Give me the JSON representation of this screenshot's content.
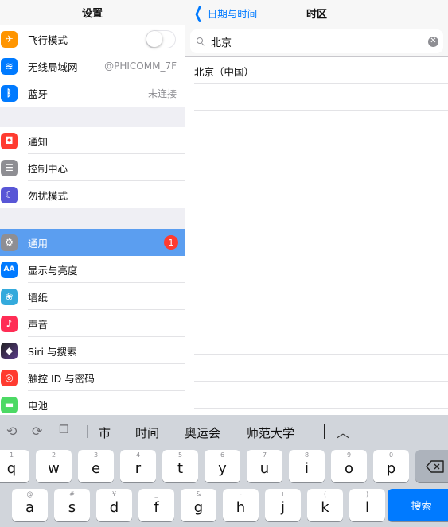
{
  "sidebar": {
    "title": "设置",
    "groups": [
      [
        {
          "label": "飞行模式",
          "icon": "airplane-icon",
          "color": "#ff9500",
          "glyph": "✈"
        },
        {
          "label": "无线局域网",
          "icon": "wifi-icon",
          "color": "#007aff",
          "glyph": "≋",
          "value": "@PHICOMM_7F"
        },
        {
          "label": "蓝牙",
          "icon": "bluetooth-icon",
          "color": "#007aff",
          "glyph": "ᛒ",
          "value": "未连接"
        }
      ],
      [
        {
          "label": "通知",
          "icon": "notifications-icon",
          "color": "#ff3b30",
          "glyph": "◘"
        },
        {
          "label": "控制中心",
          "icon": "control-center-icon",
          "color": "#8e8e93",
          "glyph": "☰"
        },
        {
          "label": "勿扰模式",
          "icon": "moon-icon",
          "color": "#5856d6",
          "glyph": "☾"
        }
      ],
      [
        {
          "label": "通用",
          "icon": "gear-icon",
          "color": "#8e8e93",
          "glyph": "⚙",
          "badge": "1"
        },
        {
          "label": "显示与亮度",
          "icon": "display-icon",
          "color": "#007aff",
          "glyph": "AA"
        },
        {
          "label": "墙纸",
          "icon": "wallpaper-icon",
          "color": "#34aadc",
          "glyph": "❀"
        },
        {
          "label": "声音",
          "icon": "sound-icon",
          "color": "#ff2d55",
          "glyph": "♪"
        },
        {
          "label": "Siri 与搜索",
          "icon": "siri-icon",
          "color": "#333355",
          "glyph": "◆"
        },
        {
          "label": "触控 ID 与密码",
          "icon": "fingerprint-icon",
          "color": "#ff3b30",
          "glyph": "◎"
        },
        {
          "label": "电池",
          "icon": "battery-icon",
          "color": "#4cd964",
          "glyph": "▬"
        }
      ]
    ]
  },
  "detail": {
    "back_label": "日期与时间",
    "title": "时区",
    "search_value": "北京",
    "results": [
      "北京（中国）"
    ]
  },
  "keyboard": {
    "suggestions": [
      "市",
      "时间",
      "奥运会",
      "师范大学"
    ],
    "row1": [
      {
        "key": "q",
        "hint": "1"
      },
      {
        "key": "w",
        "hint": "2"
      },
      {
        "key": "e",
        "hint": "3"
      },
      {
        "key": "r",
        "hint": "4"
      },
      {
        "key": "t",
        "hint": "5"
      },
      {
        "key": "y",
        "hint": "6"
      },
      {
        "key": "u",
        "hint": "7"
      },
      {
        "key": "i",
        "hint": "8"
      },
      {
        "key": "o",
        "hint": "9"
      },
      {
        "key": "p",
        "hint": "0"
      }
    ],
    "row2": [
      {
        "key": "a",
        "hint": "@"
      },
      {
        "key": "s",
        "hint": "#"
      },
      {
        "key": "d",
        "hint": "¥"
      },
      {
        "key": "f",
        "hint": "_"
      },
      {
        "key": "g",
        "hint": "&"
      },
      {
        "key": "h",
        "hint": "-"
      },
      {
        "key": "j",
        "hint": "+"
      },
      {
        "key": "k",
        "hint": "("
      },
      {
        "key": "l",
        "hint": ")"
      }
    ],
    "search_key": "搜索"
  },
  "colors": {
    "accent": "#007aff",
    "selected_row": "#5b9ef0",
    "badge": "#ff3b30"
  }
}
